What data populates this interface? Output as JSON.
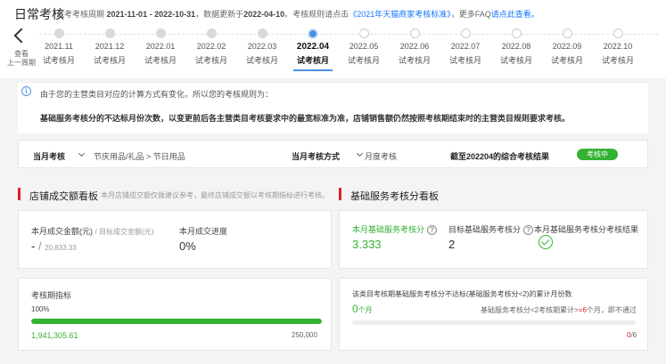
{
  "header": {
    "title": "日常考核",
    "meta_prefix": "试考考核周期",
    "meta_period": "2021-11-01 - 2022-10-31",
    "meta_mid": "，数据更新于",
    "meta_updated": "2022-04-10",
    "meta_rule_prefix": "。考核规则请点击",
    "meta_rule_link": "《2021年天猫商家考核标准》",
    "meta_faq_prefix": "，更多FAQ",
    "meta_faq_link": "请点此查看。"
  },
  "timeline": {
    "back_label_1": "查看",
    "back_label_2": "上一周期",
    "periods": [
      {
        "ym": "2021.11",
        "tag": "试考核月",
        "state": "past"
      },
      {
        "ym": "2021.12",
        "tag": "试考核月",
        "state": "past"
      },
      {
        "ym": "2022.01",
        "tag": "试考核月",
        "state": "past"
      },
      {
        "ym": "2022.02",
        "tag": "试考核月",
        "state": "past"
      },
      {
        "ym": "2022.03",
        "tag": "试考核月",
        "state": "past"
      },
      {
        "ym": "2022.04",
        "tag": "试考核月",
        "state": "active"
      },
      {
        "ym": "2022.05",
        "tag": "试考核月",
        "state": "future"
      },
      {
        "ym": "2022.06",
        "tag": "试考核月",
        "state": "future"
      },
      {
        "ym": "2022.07",
        "tag": "试考核月",
        "state": "future"
      },
      {
        "ym": "2022.08",
        "tag": "试考核月",
        "state": "future"
      },
      {
        "ym": "2022.09",
        "tag": "试考核月",
        "state": "future"
      },
      {
        "ym": "2022.10",
        "tag": "试考核月",
        "state": "future"
      }
    ]
  },
  "notice": {
    "line1": "由于您的主营类目对应的计算方式有变化，所以您的考核规则为：",
    "line2": "基础服务考核分的不达标月份次数，以变更前后各主营类目考核要求中的最宽标准为准，店铺销售额仍然按照考核期结束时的主营类目规则要求考核。"
  },
  "rule": {
    "current_label": "当月考核",
    "current_value": "节庆用品/礼品 > 节日用品",
    "method_label": "当月考核方式",
    "method_value": "月度考核",
    "result_label": "截至202204的综合考核结果",
    "result_badge": "考核中"
  },
  "sales": {
    "title": "店铺成交额看板",
    "subtitle": "本月店铺成交额仅做建议参考，最终店铺成交额以考核期指标进行考核。",
    "amount_label": "本月成交金额(元)",
    "target_label": "目标成交金额(元)",
    "amount_value": "-",
    "slash": "/",
    "target_value": "20,833.33",
    "progress_label": "本月成交进度",
    "progress_value": "0%",
    "period_label": "考核期指标",
    "period_percent": "100%",
    "period_progress": 1.0,
    "period_current": "1,941,305.61",
    "period_target": "250,000"
  },
  "service": {
    "title": "基础服务考核分看板",
    "score_label": "本月基础服务考核分",
    "score_value": "3.333",
    "target_label": "目标基础服务考核分",
    "target_value": "2",
    "result_label": "本月基础服务考核分考核结果",
    "fail_desc": "该类目考核期基础服务考核分不达标(基础服务考核分<2)的累计月份数",
    "fail_count": "0",
    "fail_unit": "个月",
    "rule_prefix": "基础服务考核分<2考核期累计>",
    "rule_number": "=6",
    "rule_suffix": "个月，即不通过",
    "fail_current": "0",
    "fail_total": "/6",
    "fail_progress": 0.0
  },
  "colors": {
    "accent_blue": "#4a90e2",
    "green": "#34b233",
    "red": "#e02020"
  }
}
